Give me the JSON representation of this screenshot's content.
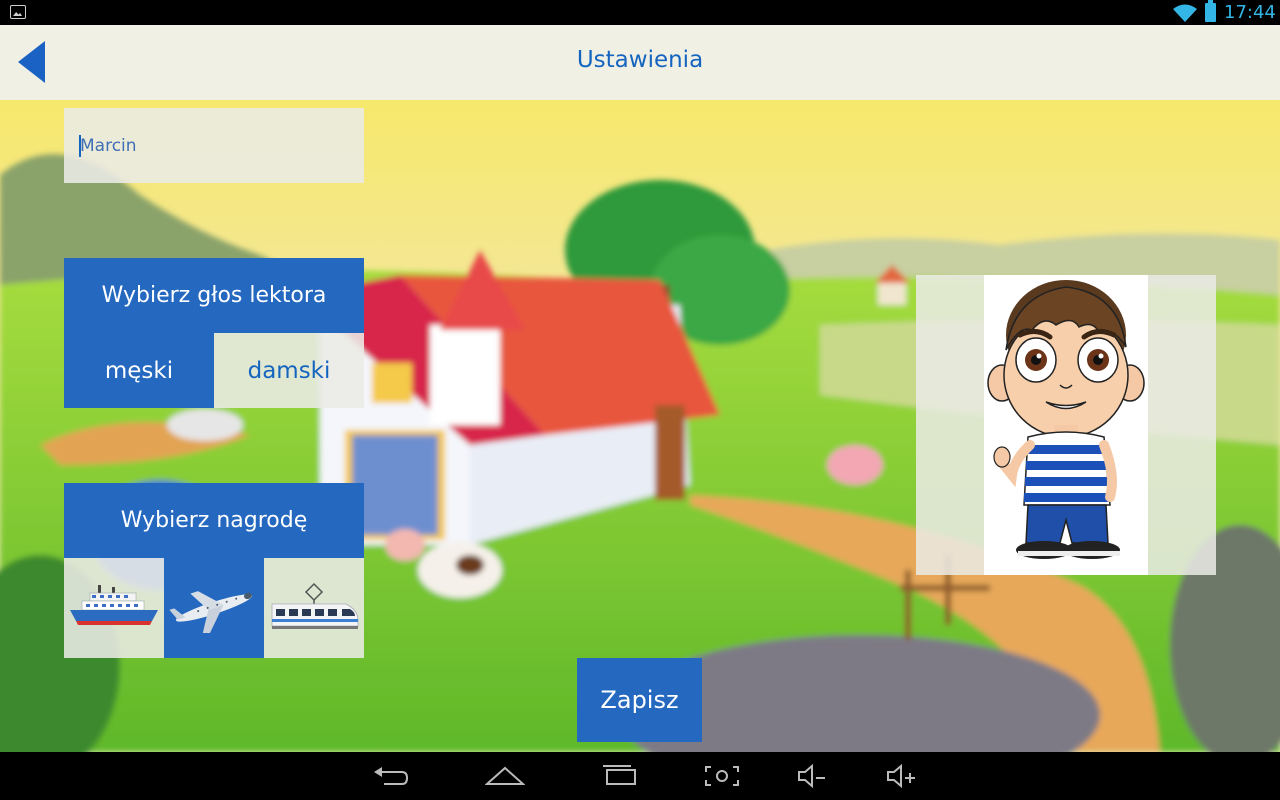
{
  "status_bar": {
    "time": "17:44",
    "icons": [
      "image-notification-icon",
      "wifi-icon",
      "battery-icon"
    ],
    "accent": "#33b5e5"
  },
  "header": {
    "title": "Ustawienia",
    "back_icon": "back-arrow-icon"
  },
  "name_field": {
    "value": "Marcin"
  },
  "voice": {
    "heading": "Wybierz głos lektora",
    "options": [
      {
        "label": "męski",
        "selected": true
      },
      {
        "label": "damski",
        "selected": false
      }
    ]
  },
  "reward": {
    "heading": "Wybierz nagrodę",
    "options": [
      {
        "icon": "ship-icon",
        "selected": false
      },
      {
        "icon": "airplane-icon",
        "selected": true
      },
      {
        "icon": "train-icon",
        "selected": false
      }
    ]
  },
  "avatar": {
    "icon": "boy-avatar"
  },
  "save_label": "Zapisz",
  "nav_bar": {
    "buttons": [
      "back-nav-icon",
      "home-nav-icon",
      "recent-apps-icon",
      "screenshot-icon",
      "volume-down-icon",
      "volume-up-icon"
    ]
  },
  "colors": {
    "primary": "#2468c0",
    "title_text": "#1565c0"
  }
}
